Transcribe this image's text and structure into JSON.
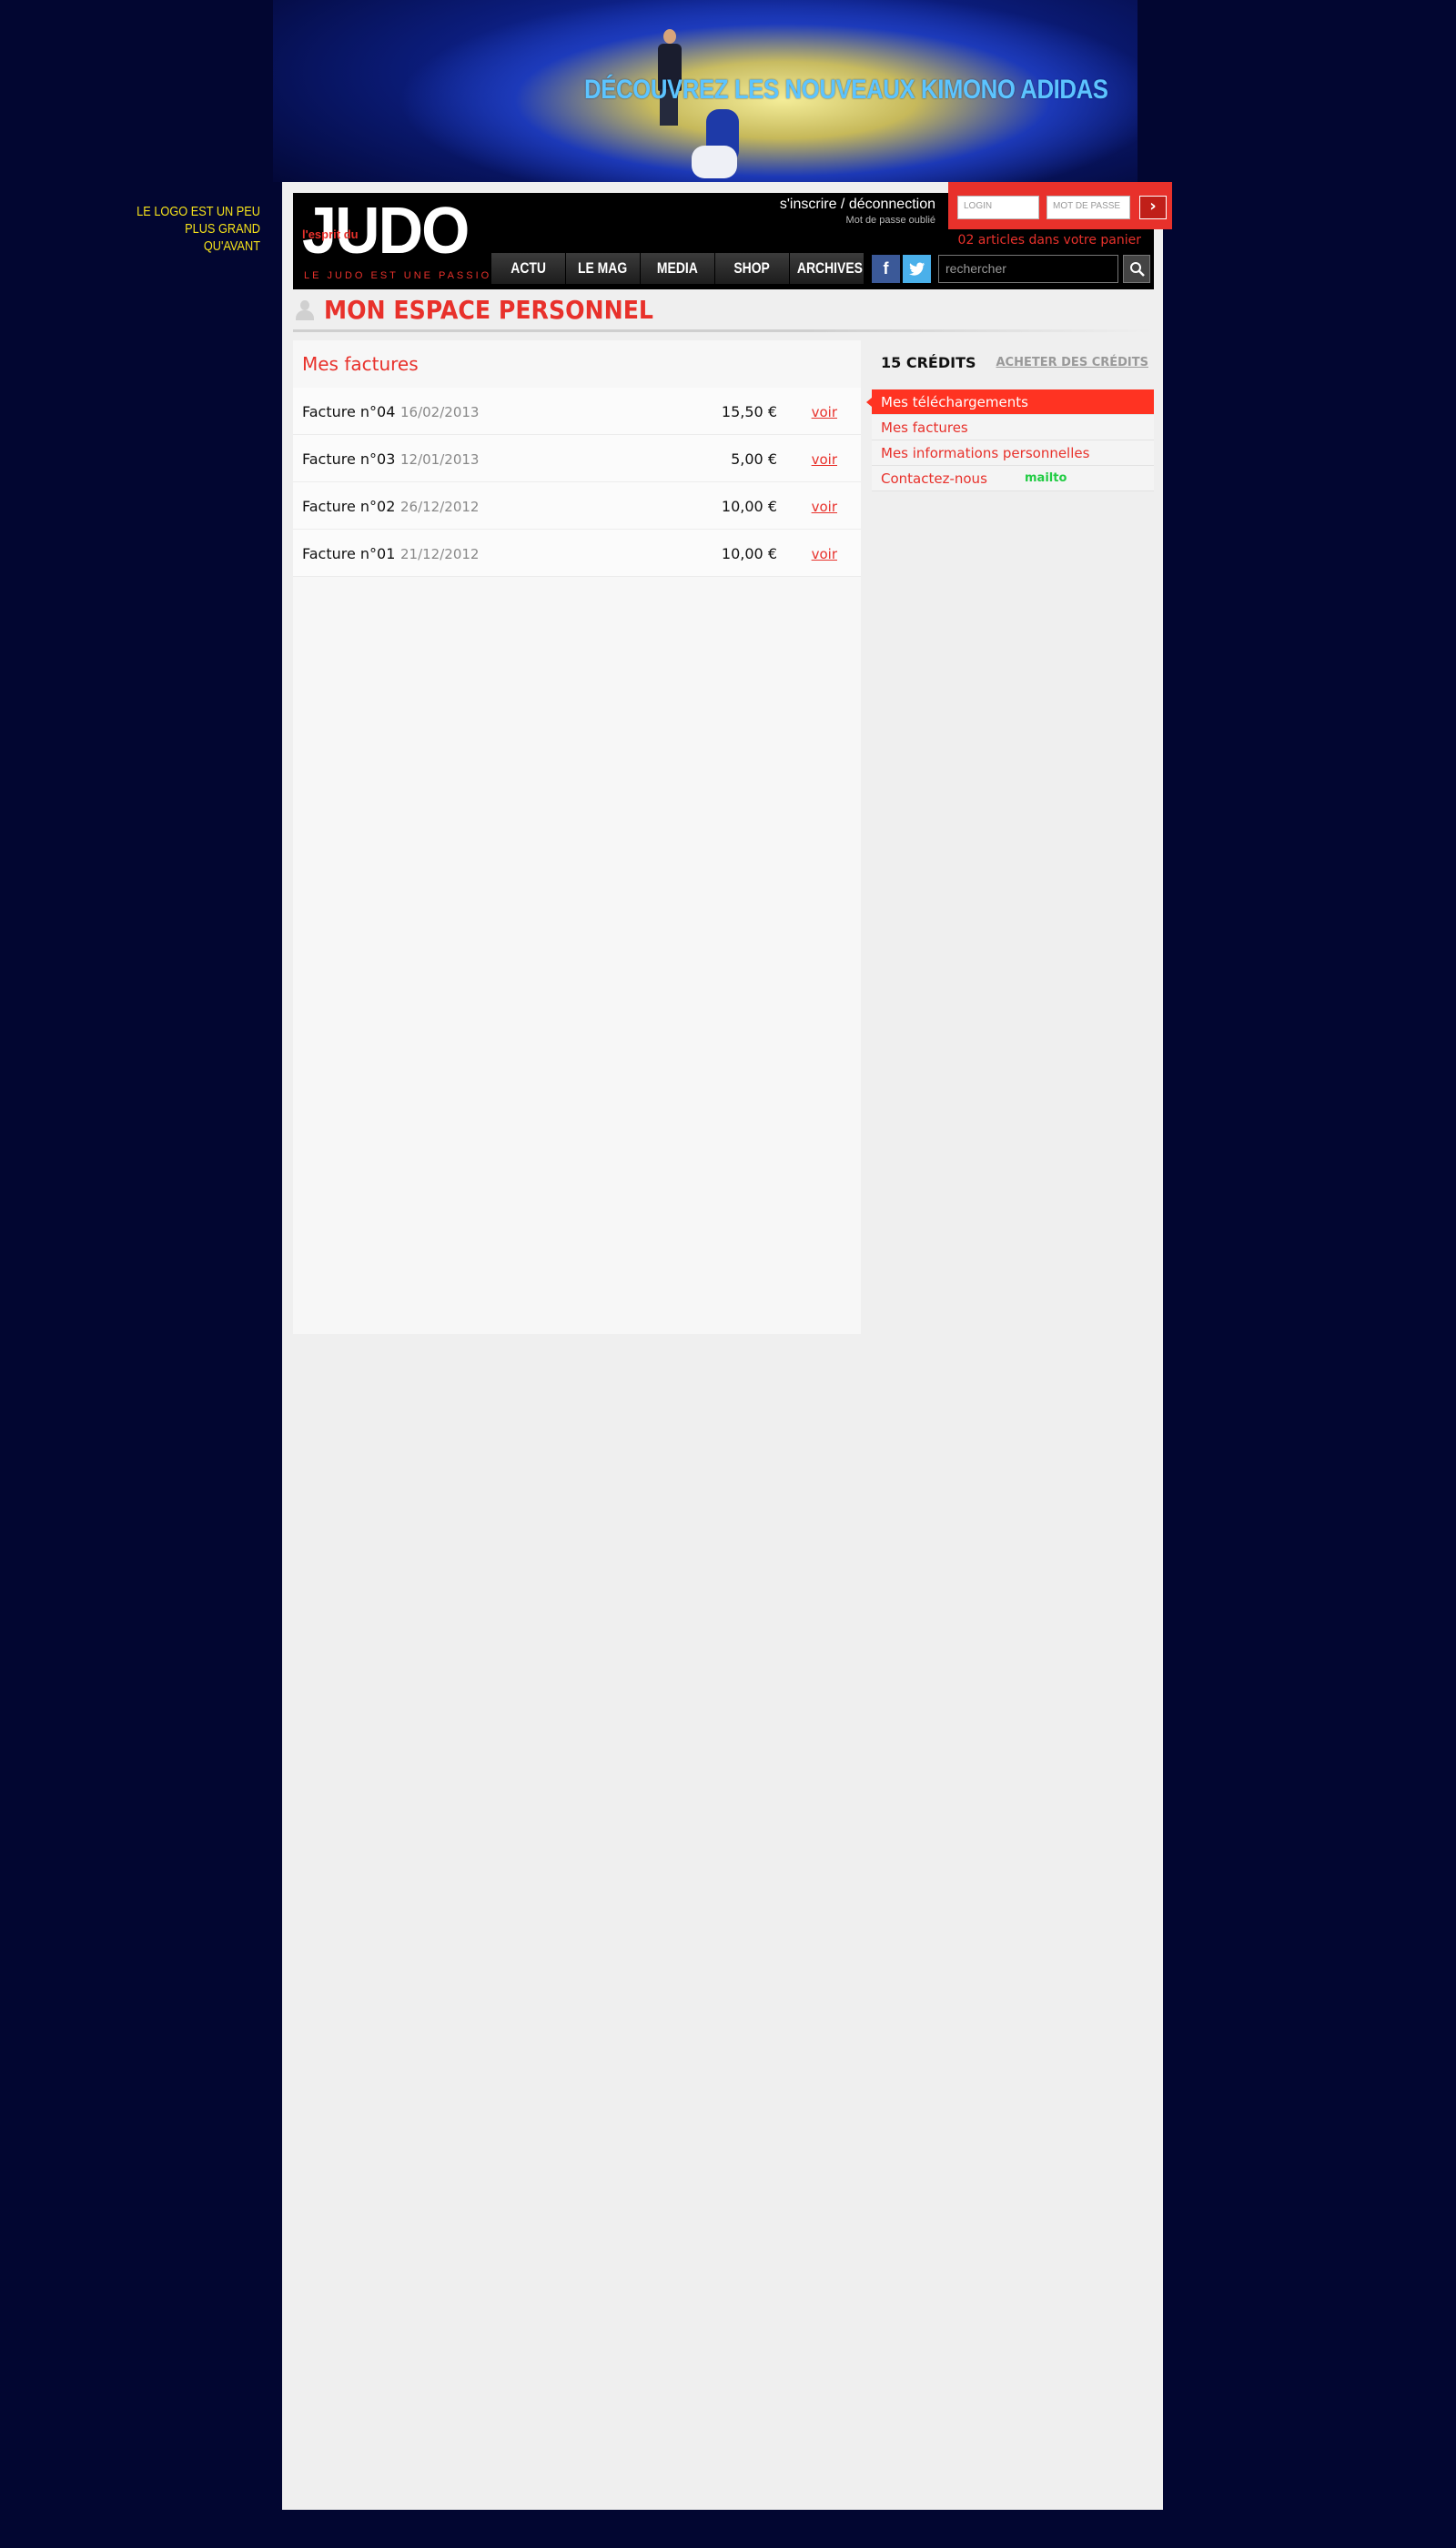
{
  "banner": {
    "title": "DÉCOUVREZ LES NOUVEAUX KIMONO ADIDAS"
  },
  "side_note": {
    "lines": [
      "LE LOGO EST UN PEU",
      "PLUS GRAND",
      "QU'AVANT"
    ]
  },
  "header": {
    "logo_small": "l'esprit du",
    "logo_big": "JUDO",
    "logo_tagline": "LE JUDO EST UNE PASSION",
    "auth_link": "s'inscrire / déconnection",
    "forgot_password": "Mot de passe oublié",
    "login_placeholder": "LOGIN",
    "password_placeholder": "MOT DE PASSE",
    "cart_text": "02 articles dans votre panier",
    "nav": [
      "ACTU",
      "LE MAG",
      "MEDIA",
      "SHOP",
      "ARCHIVES"
    ],
    "search_placeholder": "rechercher"
  },
  "section": {
    "title": "MON ESPACE PERSONNEL"
  },
  "invoices": {
    "title": "Mes factures",
    "rows": [
      {
        "name": "Facture n°04",
        "date": "16/02/2013",
        "amount": "15,50 €",
        "link": "voir"
      },
      {
        "name": "Facture n°03",
        "date": "12/01/2013",
        "amount": "5,00 €",
        "link": "voir"
      },
      {
        "name": "Facture n°02",
        "date": "26/12/2012",
        "amount": "10,00 €",
        "link": "voir"
      },
      {
        "name": "Facture n°01",
        "date": "21/12/2012",
        "amount": "10,00 €",
        "link": "voir"
      }
    ]
  },
  "sidebar": {
    "credits": "15 CRÉDITS",
    "buy_credits": "ACHETER DES CRÉDITS",
    "menu": [
      {
        "label": "Mes téléchargements",
        "active": true
      },
      {
        "label": "Mes factures",
        "active": false
      },
      {
        "label": "Mes informations personnelles",
        "active": false
      },
      {
        "label": "Contactez-nous",
        "active": false
      }
    ],
    "mailto": "mailto"
  },
  "colors": {
    "accent": "#e8312b",
    "background": "#020631",
    "banner_title": "#5cc4ff",
    "note": "#f5e21a",
    "mailto": "#22cc44"
  }
}
